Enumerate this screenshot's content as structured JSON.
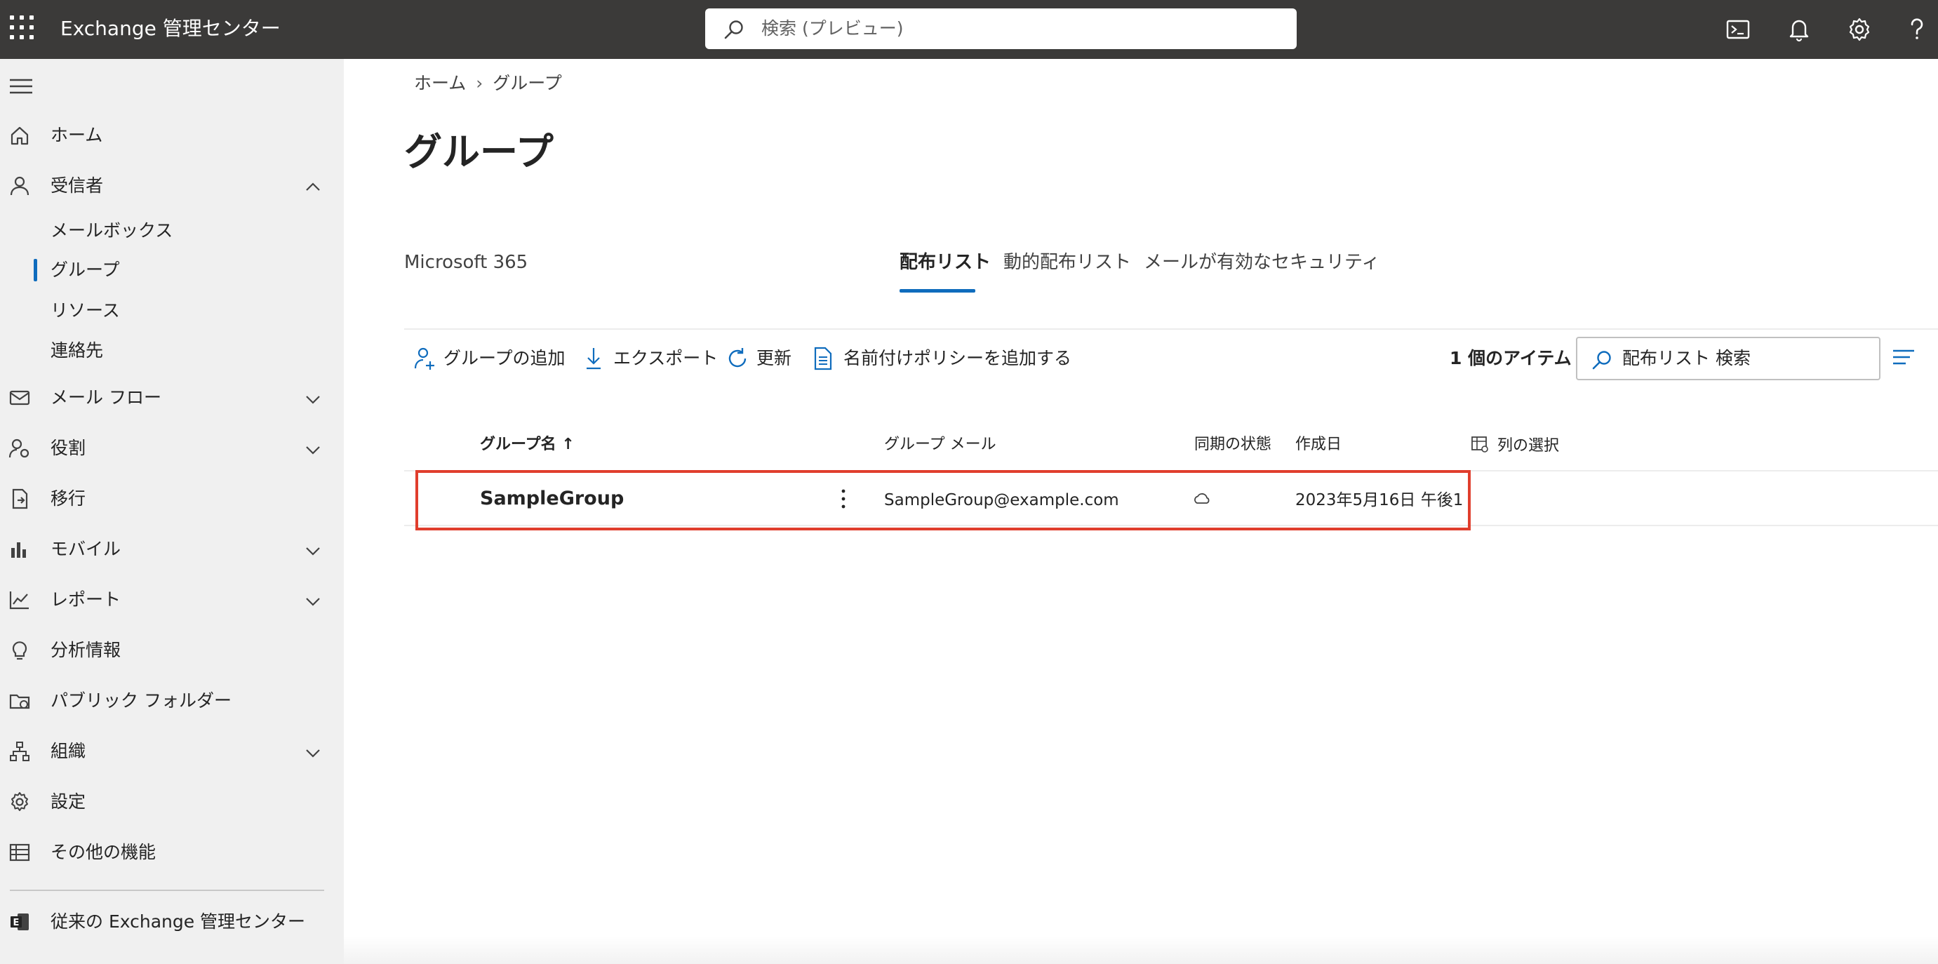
{
  "header": {
    "app_title": "Exchange 管理センター",
    "search_placeholder": "検索 (プレビュー)",
    "icons": [
      "waffle-icon",
      "terminal-icon",
      "bell-icon",
      "gear-icon",
      "help-icon"
    ]
  },
  "sidebar": {
    "items": [
      {
        "label": "ホーム",
        "icon": "home-icon"
      },
      {
        "label": "受信者",
        "icon": "person-icon",
        "expanded": true
      },
      {
        "label": "メールボックス"
      },
      {
        "label": "グループ",
        "selected": true
      },
      {
        "label": "リソース"
      },
      {
        "label": "連絡先"
      },
      {
        "label": "メール フロー",
        "icon": "mail-icon"
      },
      {
        "label": "役割",
        "icon": "role-icon"
      },
      {
        "label": "移行",
        "icon": "migration-icon"
      },
      {
        "label": "モバイル",
        "icon": "mobile-icon"
      },
      {
        "label": "レポート",
        "icon": "report-icon"
      },
      {
        "label": "分析情報",
        "icon": "lightbulb-icon"
      },
      {
        "label": "パブリック フォルダー",
        "icon": "public-folder-icon"
      },
      {
        "label": "組織",
        "icon": "org-icon"
      },
      {
        "label": "設定",
        "icon": "settings-icon"
      },
      {
        "label": "その他の機能",
        "icon": "table-icon"
      }
    ],
    "classic_link": "従来の Exchange 管理センター"
  },
  "main": {
    "breadcrumb": [
      "ホーム",
      "グループ"
    ],
    "page_title": "グループ",
    "tabs": [
      {
        "label": "Microsoft 365"
      },
      {
        "label": "配布リスト",
        "active": true
      },
      {
        "label": "動的配布リスト"
      },
      {
        "label": "メールが有効なセキュリティ"
      }
    ],
    "commands": {
      "add_group": "グループの追加",
      "export": "エクスポート",
      "refresh": "更新",
      "naming_policy": "名前付けポリシーを追加する"
    },
    "items_count": "1 個のアイテム",
    "list_search_value": "配布リスト 検索",
    "columns": {
      "name": "グループ名 ↑",
      "email": "グループ メール",
      "sync": "同期の状態",
      "created": "作成日",
      "choose_columns": "列の選択"
    },
    "rows": [
      {
        "name": "SampleGroup",
        "email": "SampleGroup@example.com",
        "sync": "cloud-icon",
        "created": "2023年5月16日 午後1"
      }
    ]
  },
  "colors": {
    "accent": "#0f6cbd",
    "highlight": "#e03e2d",
    "topbar": "#3b3a39",
    "sidebar": "#f0f0f0"
  }
}
